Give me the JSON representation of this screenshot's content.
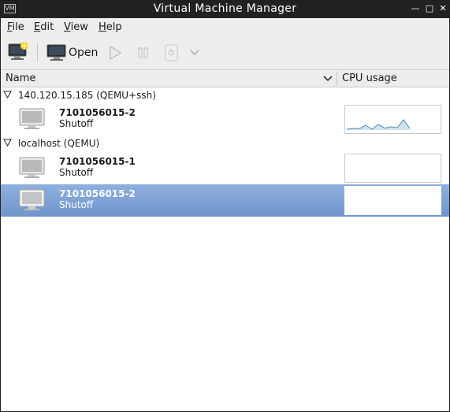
{
  "window": {
    "title": "Virtual Machine Manager",
    "app_icon_text": "VM"
  },
  "menu": [
    {
      "label": "File"
    },
    {
      "label": "Edit"
    },
    {
      "label": "View"
    },
    {
      "label": "Help"
    }
  ],
  "toolbar": {
    "new_vm_icon": "new-vm-icon",
    "open_label": "Open",
    "open_icon": "monitor-icon",
    "run_icon": "play-icon",
    "pause_icon": "pause-icon",
    "shutdown_icon": "power-icon",
    "shutdown_menu_icon": "chevron-down-icon"
  },
  "columns": {
    "name": "Name",
    "cpu": "CPU usage"
  },
  "connections": [
    {
      "label": "140.120.15.185 (QEMU+ssh)",
      "expanded": true,
      "vms": [
        {
          "name": "7101056015-2",
          "status": "Shutoff",
          "selected": false,
          "cpu_history": [
            0.05,
            0.1,
            0.08,
            0.3,
            0.05,
            0.35,
            0.12,
            0.2,
            0.15,
            0.65,
            0.1
          ]
        }
      ]
    },
    {
      "label": "localhost (QEMU)",
      "expanded": true,
      "vms": [
        {
          "name": "7101056015-1",
          "status": "Shutoff",
          "selected": false,
          "cpu_history": []
        },
        {
          "name": "7101056015-2",
          "status": "Shutoff",
          "selected": true,
          "cpu_history": []
        }
      ]
    }
  ],
  "colors": {
    "titlebar": "#222222",
    "selection": "#7b9fd3",
    "graph_line": "#4a8cb6"
  }
}
